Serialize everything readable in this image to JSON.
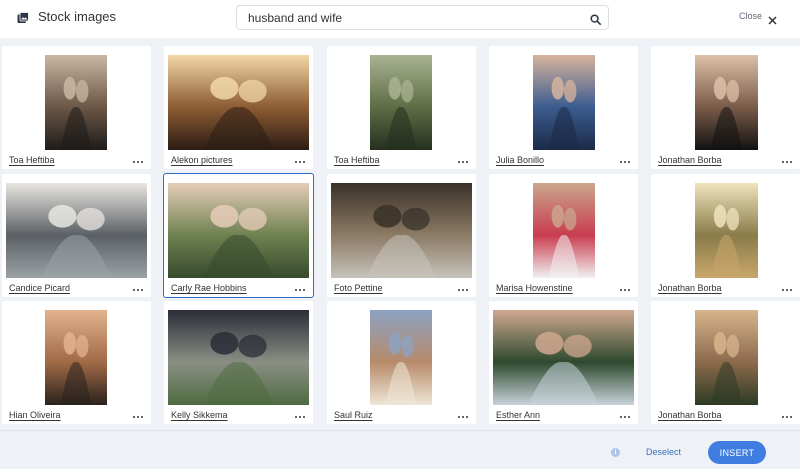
{
  "header": {
    "title": "Stock images",
    "search_value": "husband and wife",
    "close_label": "Close"
  },
  "photos": [
    {
      "author": "Toa Heftiba",
      "colors": [
        "#1e1c1a",
        "#6c5646",
        "#c9b7a3"
      ]
    },
    {
      "author": "Alekon pictures",
      "colors": [
        "#2b1d14",
        "#8d5c34",
        "#f2d7a6"
      ]
    },
    {
      "author": "Toa Heftiba",
      "colors": [
        "#25301f",
        "#5e6d45",
        "#a9b392"
      ]
    },
    {
      "author": "Julia Bonillo",
      "colors": [
        "#1c2a47",
        "#3b5c8f",
        "#d7b49e"
      ]
    },
    {
      "author": "Jonathan Borba",
      "colors": [
        "#121212",
        "#7a5b48",
        "#dcc0a8"
      ]
    },
    {
      "author": "Candice Picard",
      "colors": [
        "#9aa2a6",
        "#5b6064",
        "#e9e6e1"
      ]
    },
    {
      "author": "Carly Rae Hobbins",
      "colors": [
        "#374a2d",
        "#6f8150",
        "#e6cdb9"
      ]
    },
    {
      "author": "Foto Pettine",
      "colors": [
        "#c6c2ba",
        "#8c7b65",
        "#3a3128"
      ]
    },
    {
      "author": "Marisa Howenstine",
      "colors": [
        "#f1f1f1",
        "#c93c4f",
        "#caa68d"
      ]
    },
    {
      "author": "Jonathan Borba",
      "colors": [
        "#c8a66b",
        "#8a7c4a",
        "#f0e3bd"
      ]
    },
    {
      "author": "Hian Oliveira",
      "colors": [
        "#2a221d",
        "#a06a46",
        "#e3b38d"
      ]
    },
    {
      "author": "Kelly Sikkema",
      "colors": [
        "#4f6b40",
        "#8a8f84",
        "#2c2d38"
      ]
    },
    {
      "author": "Saul Ruiz",
      "colors": [
        "#efe6d7",
        "#b78b6a",
        "#8da2c2"
      ]
    },
    {
      "author": "Esther Ann",
      "colors": [
        "#c7d2d9",
        "#2d4a2e",
        "#d0a890"
      ]
    },
    {
      "author": "Jonathan Borba",
      "colors": [
        "#2d3b25",
        "#8c6a4c",
        "#d6b58c"
      ]
    }
  ],
  "footer": {
    "deselect_label": "Deselect",
    "insert_label": "INSERT"
  },
  "colors": {
    "accent": "#3f7ee0",
    "selected_outline": "#2f6cc8",
    "grid_background": "#eef2f7"
  },
  "icons": {
    "title": "image-icon",
    "search": "search-icon",
    "close": "close-icon",
    "more": "more-icon",
    "info": "info-icon"
  }
}
